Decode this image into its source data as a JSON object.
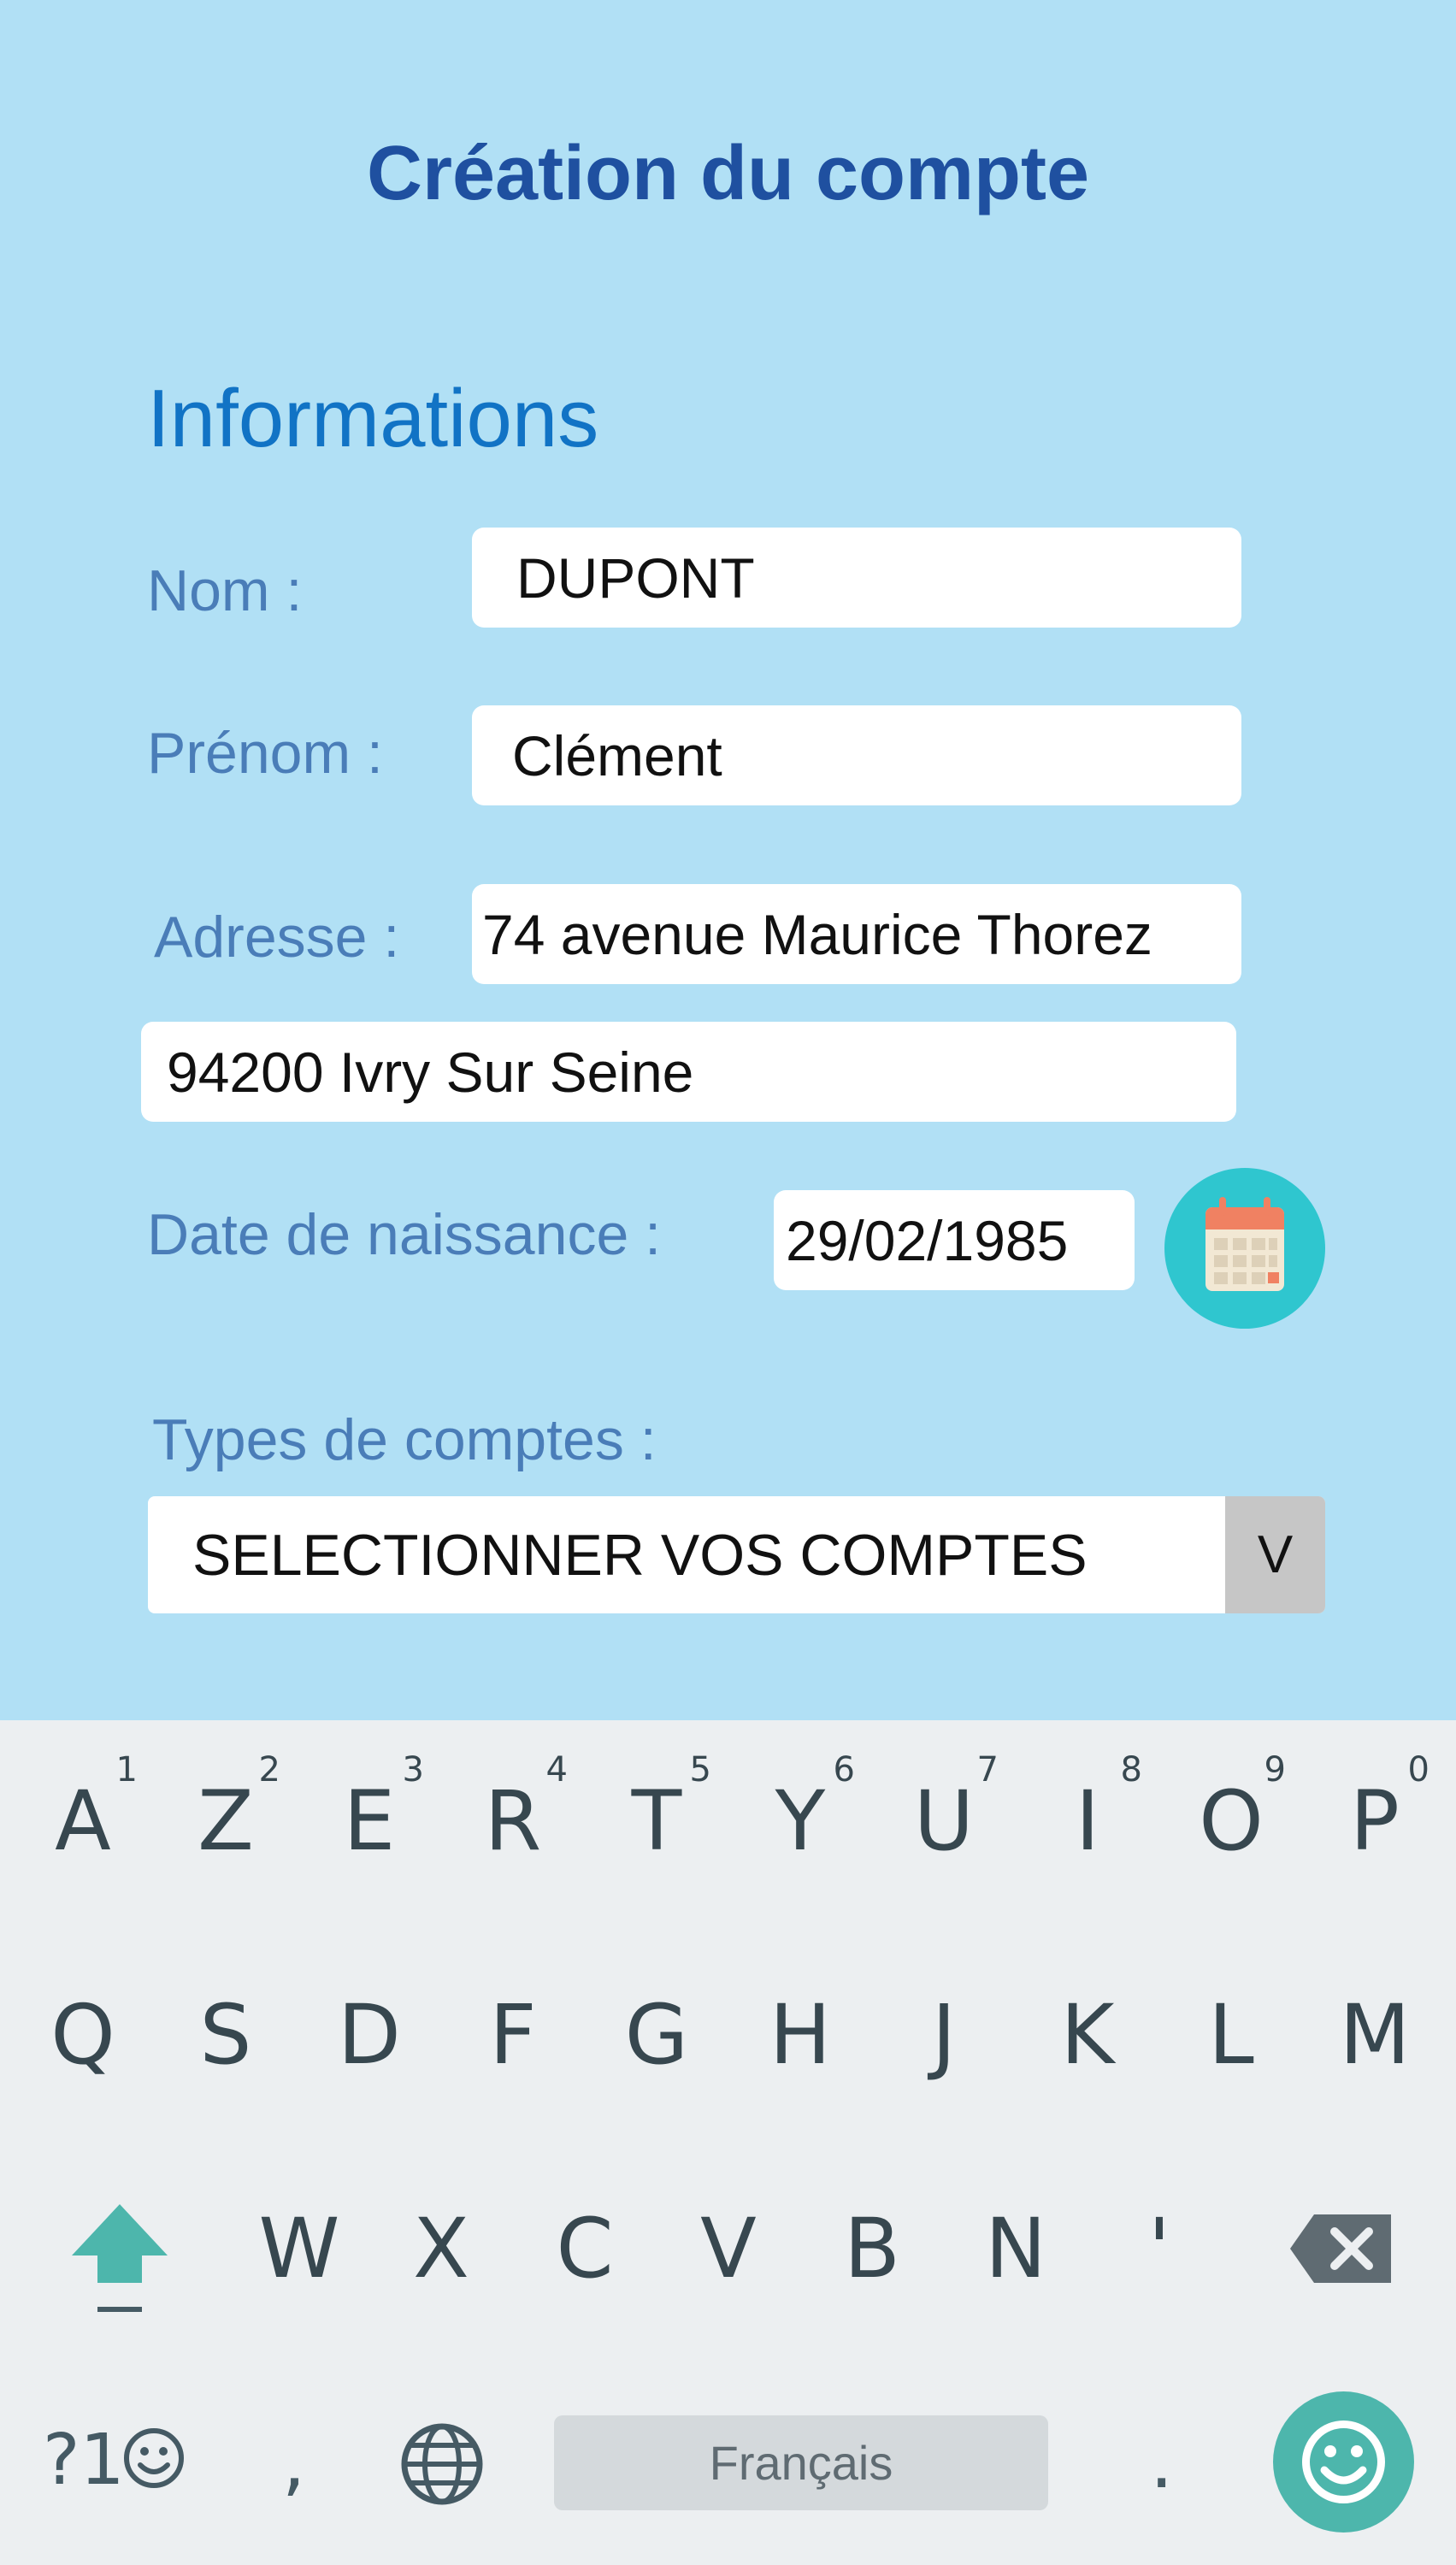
{
  "header": {
    "title": "Création du compte"
  },
  "form": {
    "section_title": "Informations",
    "nom": {
      "label": "Nom :",
      "value": "DUPONT"
    },
    "prenom": {
      "label": "Prénom :",
      "value": "Clément"
    },
    "adresse": {
      "label": "Adresse :",
      "line1": "74 avenue Maurice Thorez",
      "line2": "94200 Ivry Sur Seine"
    },
    "date_naissance": {
      "label": "Date de naissance :",
      "value": "29/02/1985",
      "calendar_icon": "calendar-icon"
    },
    "types_comptes": {
      "label": "Types de comptes :",
      "selected": "SELECTIONNER VOS COMPTES",
      "arrow": "V"
    }
  },
  "keyboard": {
    "row1": [
      {
        "key": "A",
        "hint": "1"
      },
      {
        "key": "Z",
        "hint": "2"
      },
      {
        "key": "E",
        "hint": "3"
      },
      {
        "key": "R",
        "hint": "4"
      },
      {
        "key": "T",
        "hint": "5"
      },
      {
        "key": "Y",
        "hint": "6"
      },
      {
        "key": "U",
        "hint": "7"
      },
      {
        "key": "I",
        "hint": "8"
      },
      {
        "key": "O",
        "hint": "9"
      },
      {
        "key": "P",
        "hint": "0"
      }
    ],
    "row2": [
      "Q",
      "S",
      "D",
      "F",
      "G",
      "H",
      "J",
      "K",
      "L",
      "M"
    ],
    "row3": [
      "W",
      "X",
      "C",
      "V",
      "B",
      "N",
      "'"
    ],
    "symbols_key": "?1",
    "comma_key": ",",
    "space_label": "Français",
    "period_key": ".",
    "icons": {
      "shift": "shift-icon",
      "backspace": "backspace-icon",
      "globe": "globe-icon",
      "emoji": "emoji-icon"
    },
    "colors": {
      "background": "#eceff1",
      "accent": "#4db6ac",
      "key_text": "#37474f"
    }
  },
  "colors": {
    "background": "#b1e0f5",
    "title": "#1f50a0",
    "section": "#1173c5",
    "label": "#4a7db8",
    "calendar_button": "#2fc6cf"
  }
}
